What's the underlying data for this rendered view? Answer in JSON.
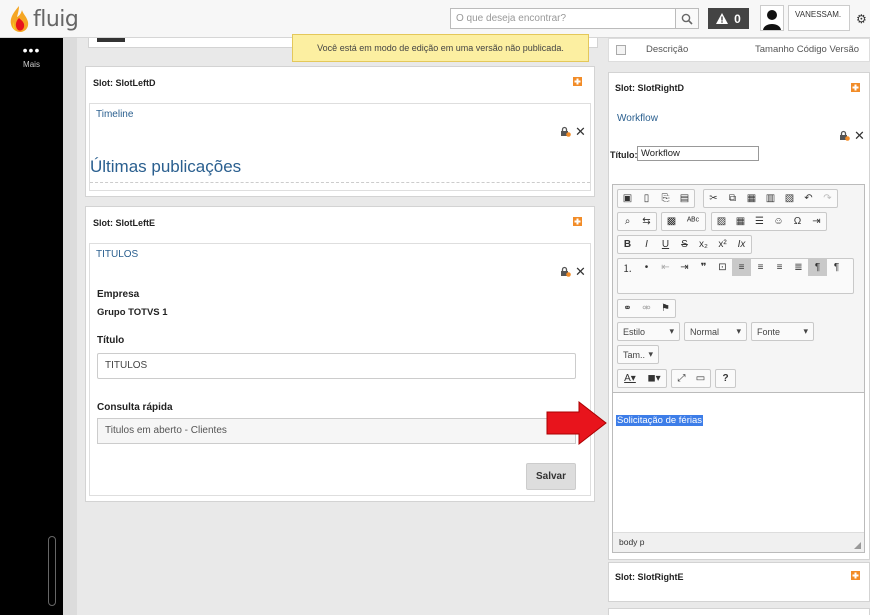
{
  "header": {
    "logo_text": "fluig",
    "search_placeholder": "O que deseja encontrar?",
    "alert_count": "0",
    "user_name": "VANESSAM."
  },
  "sidebar": {
    "more_label": "Mais"
  },
  "notice": {
    "text": "Você está em modo de edição em uma versão não publicada."
  },
  "right_header": {
    "desc_label": "Descrição",
    "columns_label": "Tamanho Código Versão"
  },
  "slot_left_d": {
    "title": "Slot: SlotLeftD",
    "widget_title": "Timeline",
    "heading": "Últimas publicações"
  },
  "slot_left_e": {
    "title": "Slot: SlotLeftE",
    "widget_title": "TITULOS",
    "empresa_label": "Empresa",
    "empresa_value": "Grupo TOTVS 1",
    "titulo_label": "Título",
    "titulo_value": "TITULOS",
    "consulta_label": "Consulta rápida",
    "consulta_value": "Titulos em aberto - Clientes",
    "save_label": "Salvar"
  },
  "slot_right_d": {
    "title": "Slot: SlotRightD",
    "widget_title": "Workflow",
    "title_field_label": "Título:",
    "title_field_value": "Workflow",
    "combo_style": "Estilo",
    "combo_format": "Normal",
    "combo_font": "Fonte",
    "combo_size": "Tam..",
    "content_text": "Solicitação de férias",
    "status_path": "body  p"
  },
  "slot_right_e": {
    "title": "Slot: SlotRightE"
  },
  "colors": {
    "accent_orange": "#f28c28",
    "link_blue": "#2a5f8f",
    "selection_blue": "#3d7de8",
    "arrow_red": "#e8141c"
  }
}
